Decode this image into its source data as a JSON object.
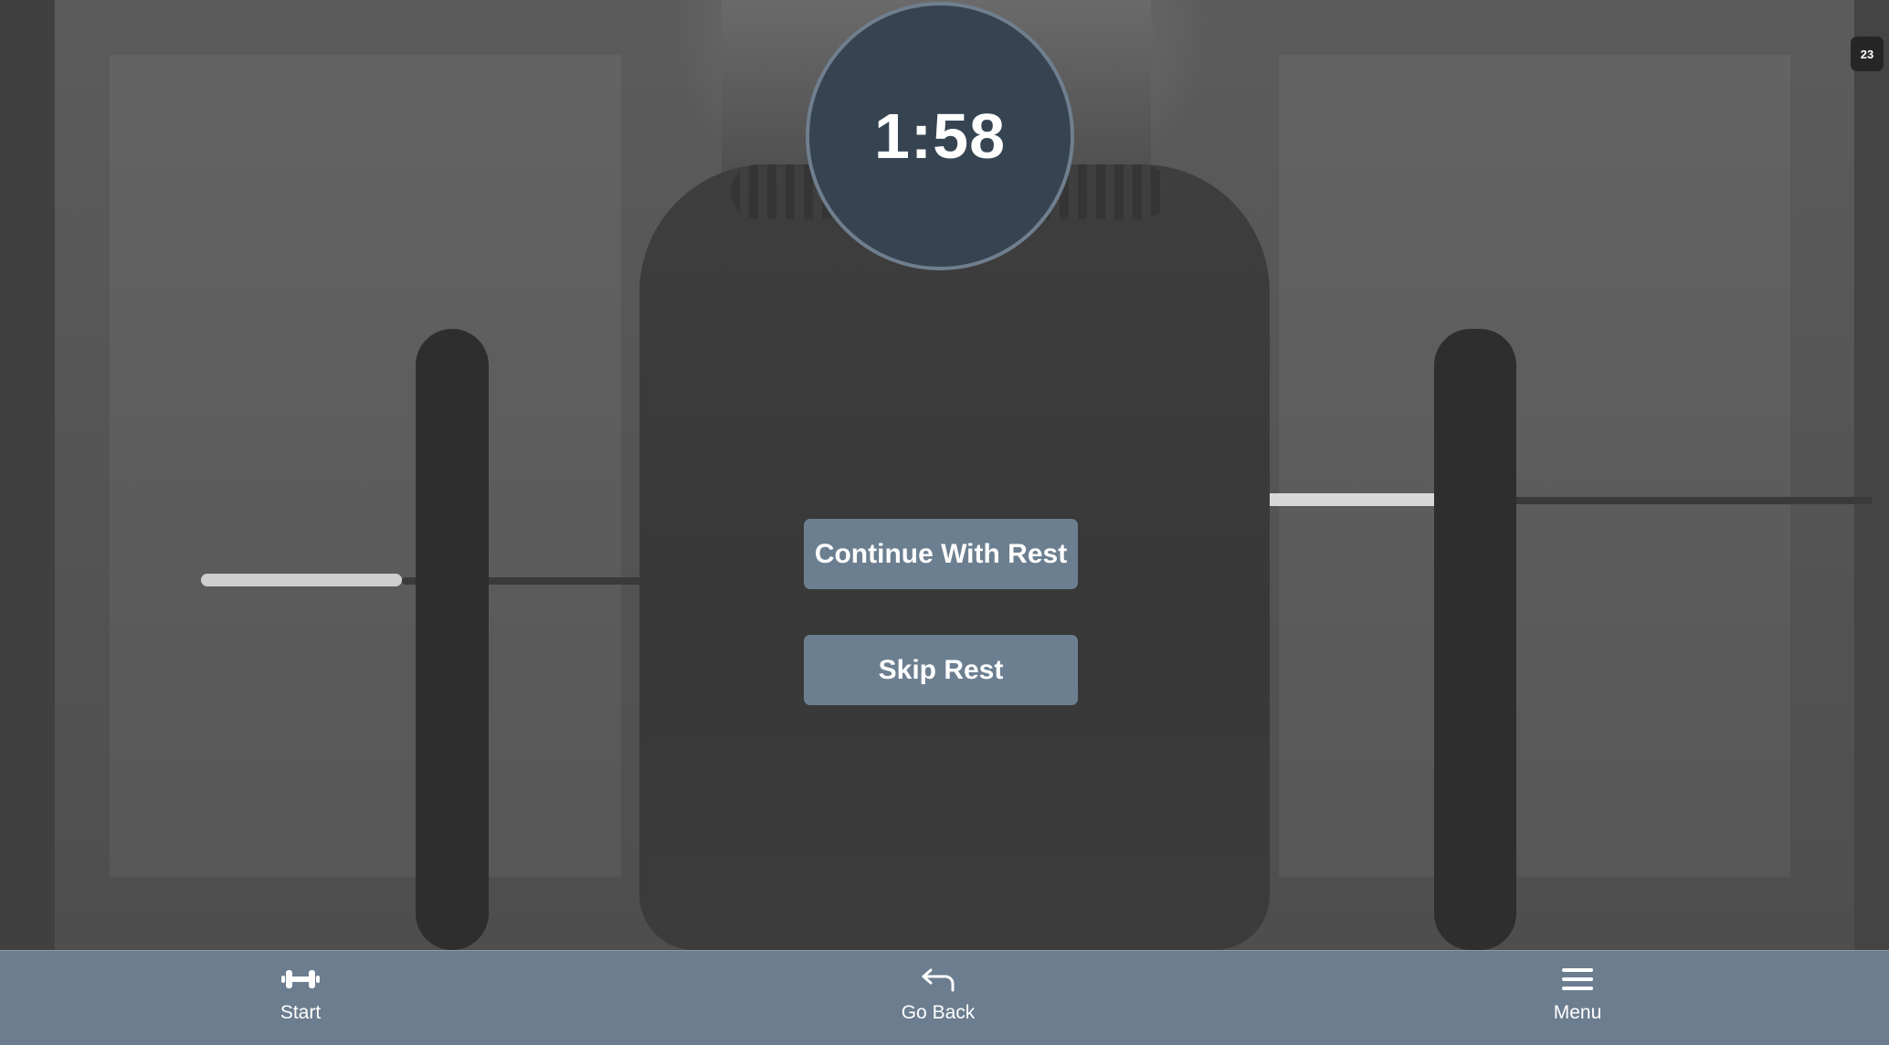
{
  "timer": {
    "display": "1:58"
  },
  "badge": {
    "text": "23"
  },
  "actions": {
    "continue_label": "Continue With Rest",
    "skip_label": "Skip Rest"
  },
  "bottom_nav": {
    "items": [
      {
        "label": "Start",
        "icon": "dumbbell-icon"
      },
      {
        "label": "Go Back",
        "icon": "undo-arrow-icon"
      },
      {
        "label": "Menu",
        "icon": "hamburger-menu-icon"
      }
    ]
  },
  "colors": {
    "timer_bg": "#364452",
    "button_bg": "#6c7f90",
    "nav_bg": "#6c7d8f",
    "badge_bg": "#262626"
  }
}
